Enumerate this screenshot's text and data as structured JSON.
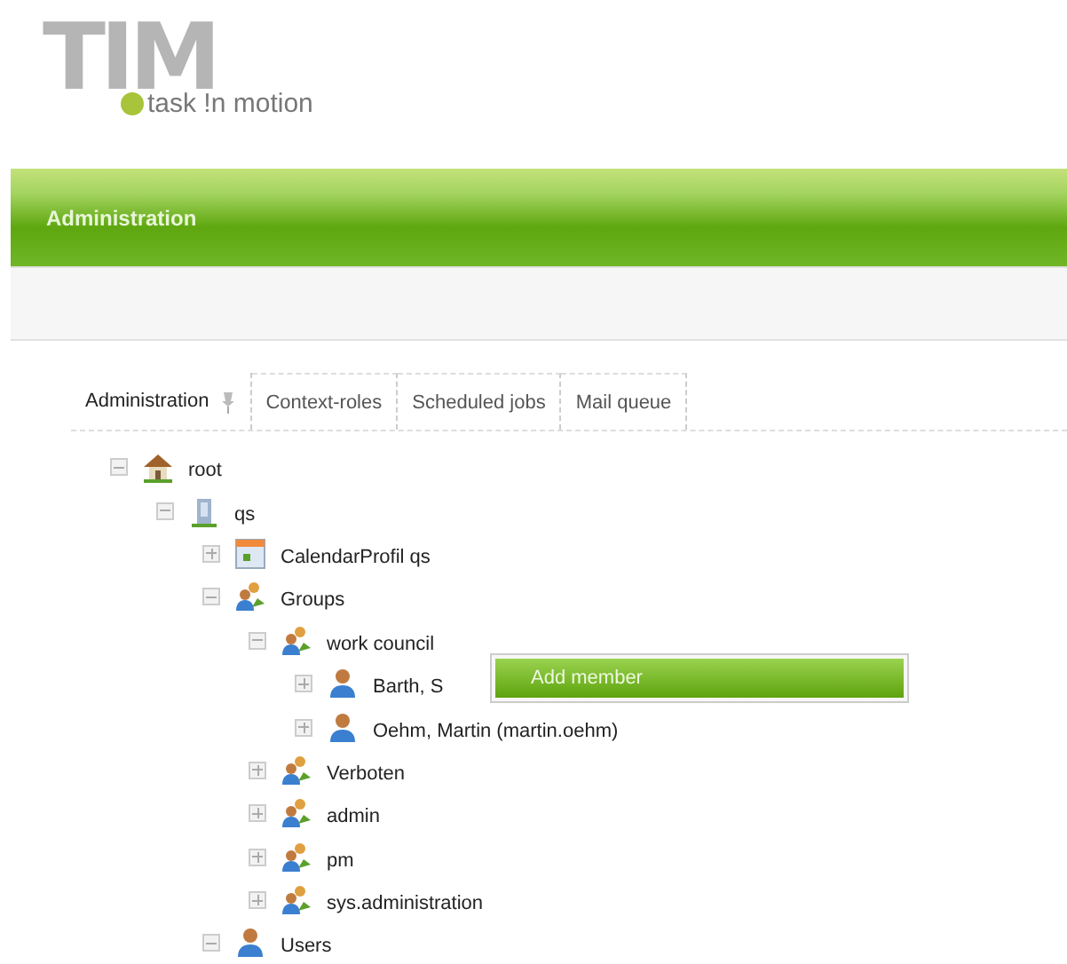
{
  "logo": {
    "letters": "TIM",
    "tagline": "task !n motion"
  },
  "header": {
    "title": "Administration"
  },
  "tabs": [
    {
      "label": "Administration",
      "selected": true
    },
    {
      "label": "Context-roles",
      "selected": false
    },
    {
      "label": "Scheduled jobs",
      "selected": false
    },
    {
      "label": "Mail queue",
      "selected": false
    }
  ],
  "tree": [
    {
      "label": "root",
      "kind": "home",
      "expanded": true,
      "children": [
        {
          "label": "qs",
          "kind": "building",
          "expanded": true,
          "children": [
            {
              "label": "CalendarProfil qs",
              "kind": "calendar",
              "expanded": false
            },
            {
              "label": "Groups",
              "kind": "group",
              "expanded": true,
              "children": [
                {
                  "label": "work council",
                  "kind": "group",
                  "expanded": true,
                  "children": [
                    {
                      "label": "Barth, S",
                      "kind": "user",
                      "expanded": false
                    },
                    {
                      "label": "Oehm, Martin (martin.oehm)",
                      "kind": "user",
                      "expanded": false
                    }
                  ]
                },
                {
                  "label": "Verboten",
                  "kind": "group",
                  "expanded": false
                },
                {
                  "label": "admin",
                  "kind": "group",
                  "expanded": false
                },
                {
                  "label": "pm",
                  "kind": "group",
                  "expanded": false
                },
                {
                  "label": "sys.administration",
                  "kind": "group",
                  "expanded": false
                }
              ]
            },
            {
              "label": "Users",
              "kind": "user",
              "expanded": true
            }
          ]
        }
      ]
    }
  ],
  "context_menu": {
    "items": [
      {
        "label": "Add member",
        "selected": true
      }
    ]
  }
}
